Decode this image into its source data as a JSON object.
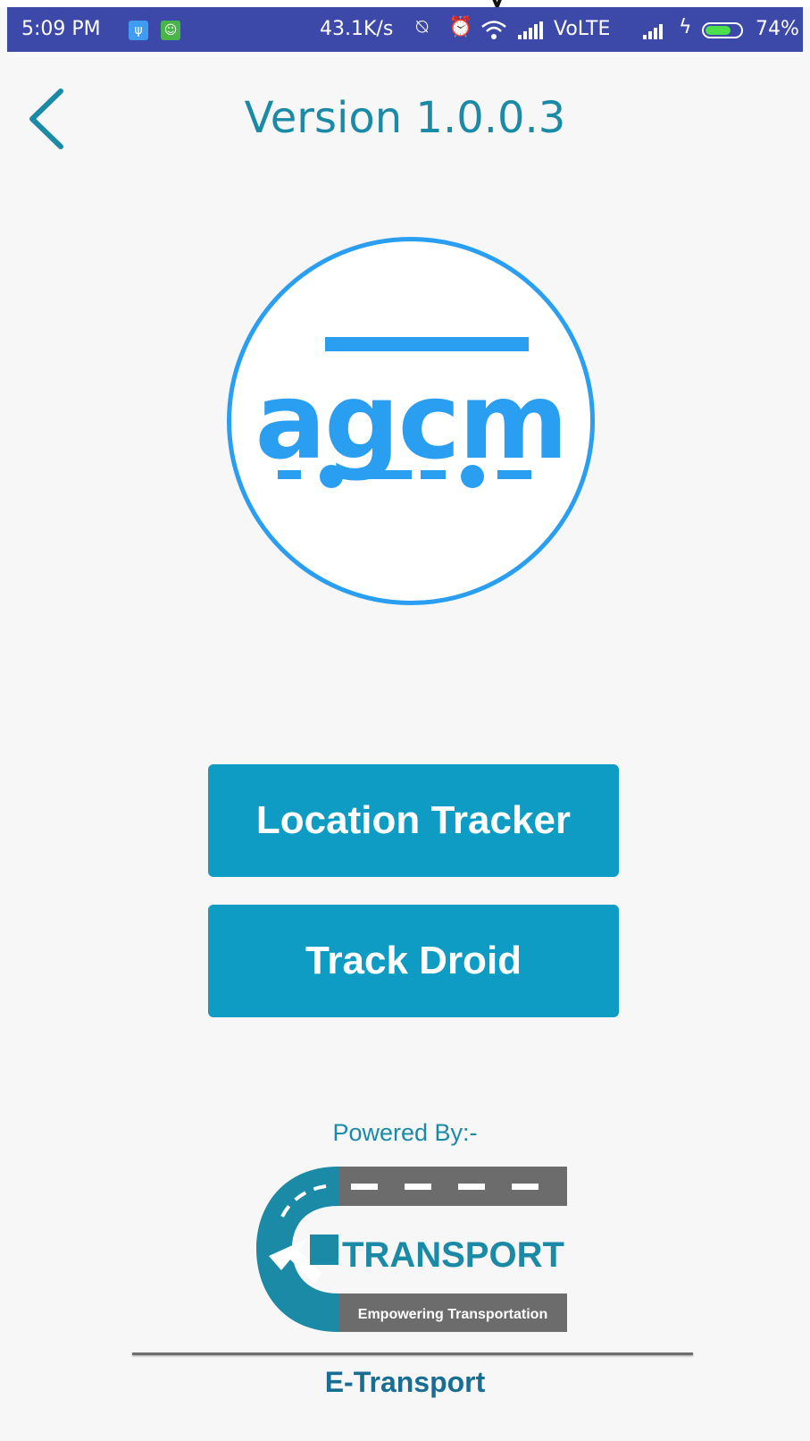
{
  "status_bar": {
    "time": "5:09 PM",
    "speed": "43.1K/s",
    "network": "VoLTE",
    "battery_percent": "74%",
    "battery_level": 0.74,
    "icons": [
      "usb-icon",
      "app-notification-icon",
      "notification-mute-icon",
      "alarm-icon",
      "wifi-icon",
      "signal-icon",
      "charging-icon",
      "battery-icon"
    ]
  },
  "header": {
    "title": "Version 1.0.0.3",
    "back_icon": "chevron-left-icon"
  },
  "app_logo": {
    "text": "agcm"
  },
  "buttons": {
    "location_tracker": "Location Tracker",
    "track_droid": "Track Droid"
  },
  "footer": {
    "powered_by": "Powered By:-",
    "logo_text": "TRANSPORT",
    "logo_tagline": "Empowering Transportation",
    "brand": "E-Transport"
  },
  "colors": {
    "status_bar": "#3d49a8",
    "accent": "#1b8aa6",
    "button": "#0e9cc4",
    "logo_blue": "#2a9ef0"
  }
}
